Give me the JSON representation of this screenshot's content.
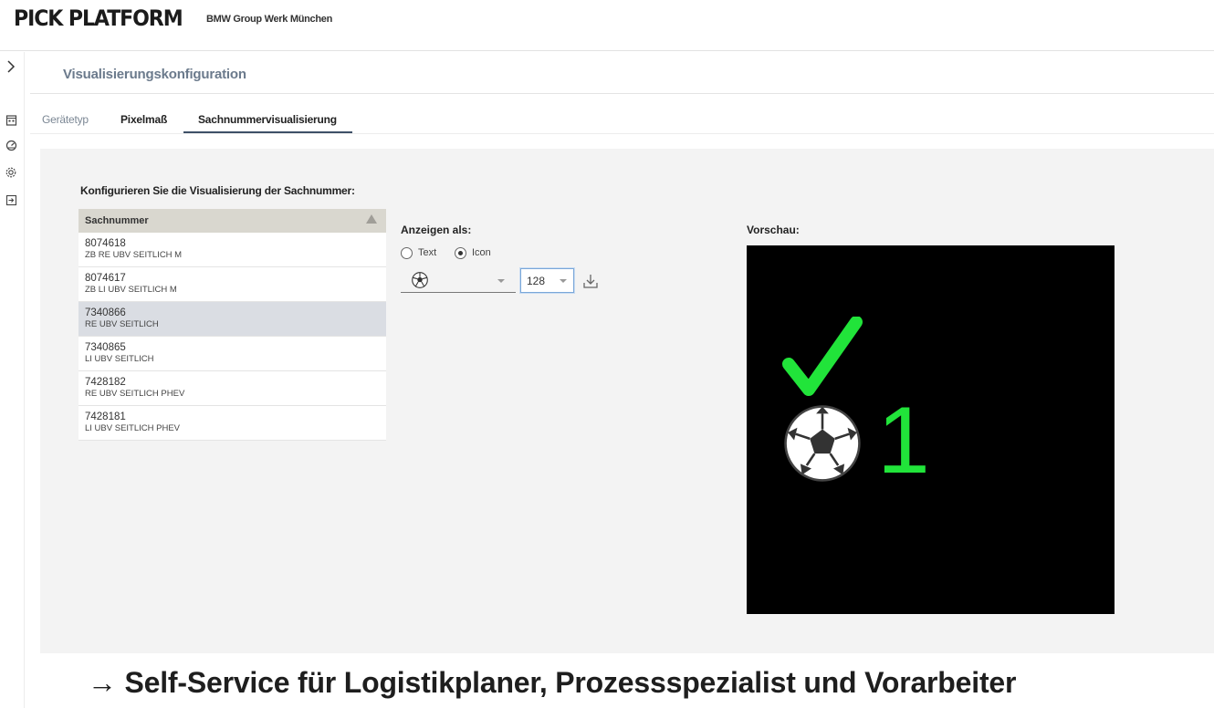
{
  "header": {
    "brand": "PICK PLATFORM",
    "subbrand": "BMW Group Werk München"
  },
  "rail": {
    "icons": [
      "chevron-right-icon",
      "building-icon",
      "dashboard-icon",
      "gear-icon",
      "logout-icon"
    ]
  },
  "page": {
    "title": "Visualisierungskonfiguration",
    "tabs": [
      "Gerätetyp",
      "Pixelmaß",
      "Sachnummervisualisierung"
    ],
    "active_tab": "Sachnummervisualisierung"
  },
  "config": {
    "label": "Konfigurieren Sie die Visualisierung der Sachnummer:",
    "table": {
      "header": "Sachnummer",
      "rows": [
        {
          "number": "8074618",
          "desc": "ZB RE UBV SEITLICH M",
          "selected": false
        },
        {
          "number": "8074617",
          "desc": "ZB LI UBV SEITLICH M",
          "selected": false
        },
        {
          "number": "7340866",
          "desc": "RE UBV SEITLICH",
          "selected": true
        },
        {
          "number": "7340865",
          "desc": "LI UBV SEITLICH",
          "selected": false
        },
        {
          "number": "7428182",
          "desc": "RE UBV SEITLICH PHEV",
          "selected": false
        },
        {
          "number": "7428181",
          "desc": "LI UBV SEITLICH PHEV",
          "selected": false
        }
      ]
    }
  },
  "display": {
    "label": "Anzeigen als:",
    "options": [
      "Text",
      "Icon"
    ],
    "selected_option": "Icon",
    "icon_value": "soccer-ball-icon",
    "size_value": "128"
  },
  "preview": {
    "label": "Vorschau:",
    "number": "1",
    "check_color": "#21e43a",
    "background": "#000000"
  },
  "caption": "→ Self-Service für Logistikplaner, Prozessspezialist und Vorarbeiter"
}
